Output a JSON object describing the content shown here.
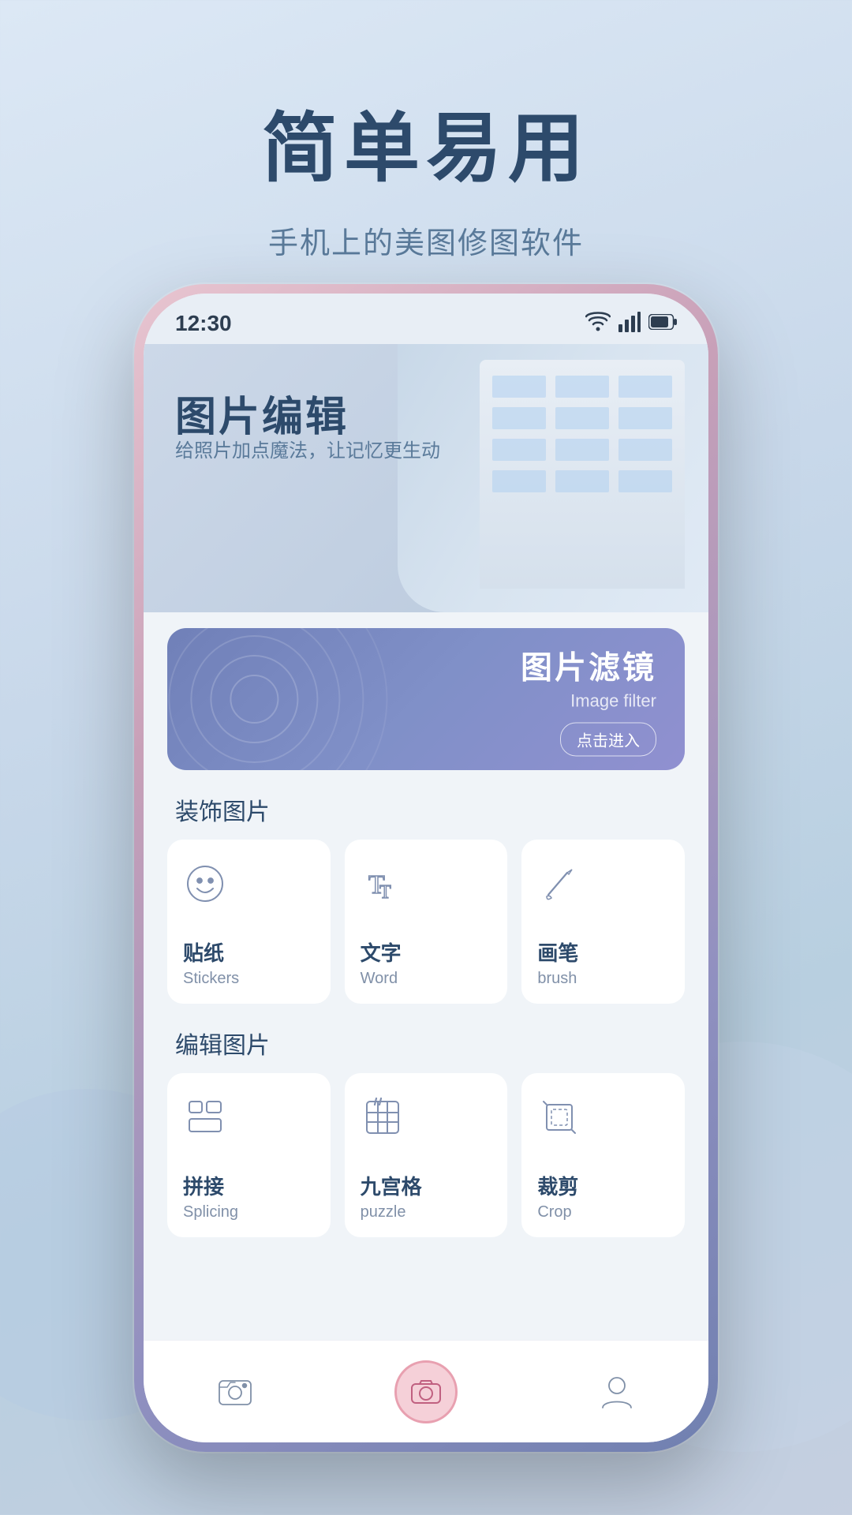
{
  "hero": {
    "title": "简单易用",
    "subtitle": "手机上的美图修图软件"
  },
  "phone": {
    "status": {
      "time": "12:30"
    },
    "banner": {
      "title": "图片编辑",
      "subtitle": "给照片加点魔法，让记忆更生动"
    },
    "filter_card": {
      "title_zh": "图片滤镜",
      "title_en": "Image filter",
      "btn_label": "点击进入"
    },
    "sections": [
      {
        "label_bold": "装饰",
        "label_normal": "图片",
        "tools": [
          {
            "name_zh": "贴纸",
            "name_en": "Stickers",
            "icon": "sticker"
          },
          {
            "name_zh": "文字",
            "name_en": "Word",
            "icon": "text"
          },
          {
            "name_zh": "画笔",
            "name_en": "brush",
            "icon": "brush"
          }
        ]
      },
      {
        "label_bold": "编辑",
        "label_normal": "图片",
        "tools": [
          {
            "name_zh": "拼接",
            "name_en": "Splicing",
            "icon": "splice"
          },
          {
            "name_zh": "九宫格",
            "name_en": "puzzle",
            "icon": "grid"
          },
          {
            "name_zh": "裁剪",
            "name_en": "Crop",
            "icon": "crop"
          }
        ]
      }
    ],
    "nav": [
      {
        "icon": "photo",
        "label": ""
      },
      {
        "icon": "camera",
        "label": ""
      },
      {
        "icon": "person",
        "label": ""
      }
    ]
  }
}
